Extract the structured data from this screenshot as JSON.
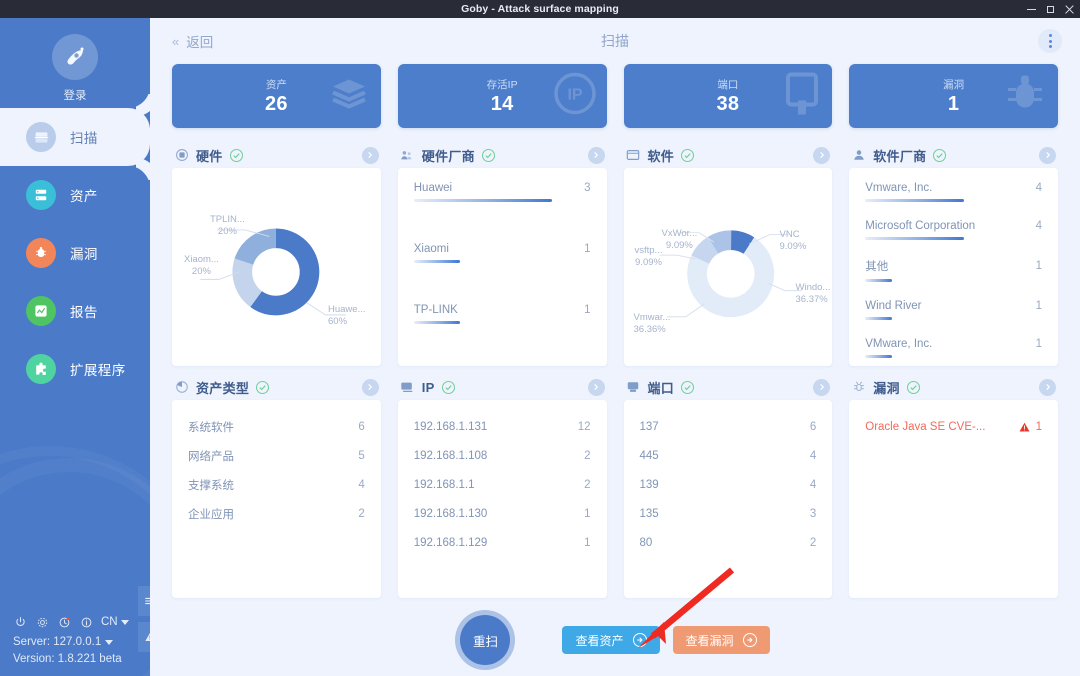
{
  "window": {
    "title": "Goby - Attack surface mapping",
    "minimize": "minimize-icon",
    "maximize": "maximize-icon",
    "close": "close-icon"
  },
  "sidebar": {
    "login_label": "登录",
    "items": [
      {
        "label": "扫描",
        "icon": "scan-icon",
        "color": "#b9cdeb",
        "active": true
      },
      {
        "label": "资产",
        "icon": "assets-icon",
        "color": "#3bbfd8",
        "active": false
      },
      {
        "label": "漏洞",
        "icon": "bug-icon",
        "color": "#f2865a",
        "active": false
      },
      {
        "label": "报告",
        "icon": "report-icon",
        "color": "#4ec463",
        "active": false
      },
      {
        "label": "扩展程序",
        "icon": "puzzle-icon",
        "color": "#4fd3a0",
        "active": false
      }
    ],
    "bottom": {
      "power_icon": "power-icon",
      "settings_icon": "gear-icon",
      "history_icon": "clock-icon",
      "info_icon": "info-icon",
      "language": "CN",
      "server": "Server: 127.0.0.1",
      "version": "Version: 1.8.221 beta",
      "menu_tab_icon": "hamburger-icon",
      "alert_tab_icon": "warning-icon"
    }
  },
  "topbar": {
    "back": "返回",
    "back_chevron": "«",
    "title": "扫描",
    "more_icon": "kebab-menu-icon"
  },
  "stats": [
    {
      "label": "资产",
      "value": "26",
      "bg_icon": "layers-icon"
    },
    {
      "label": "存活IP",
      "value": "14",
      "bg_icon": "ip-icon"
    },
    {
      "label": "端口",
      "value": "38",
      "bg_icon": "port-icon"
    },
    {
      "label": "漏洞",
      "value": "1",
      "bg_icon": "bug-icon"
    }
  ],
  "panels": {
    "hardware": {
      "title": "硬件",
      "icon": "chip-icon",
      "check_icon": "check-circle-icon",
      "arrow_icon": "chevron-right-icon"
    },
    "hardware_vendor": {
      "title": "硬件厂商",
      "icon": "factory-icon",
      "check_icon": "check-circle-icon",
      "arrow_icon": "chevron-right-icon",
      "items": [
        {
          "name": "Huawei",
          "value": "3",
          "pct": 100
        },
        {
          "name": "Xiaomi",
          "value": "1",
          "pct": 33
        },
        {
          "name": "TP-LINK",
          "value": "1",
          "pct": 33
        }
      ]
    },
    "software": {
      "title": "软件",
      "icon": "window-icon",
      "check_icon": "check-circle-icon",
      "arrow_icon": "chevron-right-icon"
    },
    "software_vendor": {
      "title": "软件厂商",
      "icon": "user-icon",
      "check_icon": "check-circle-icon",
      "arrow_icon": "chevron-right-icon",
      "items": [
        {
          "name": "Vmware, Inc.",
          "value": "4",
          "pct": 100
        },
        {
          "name": "Microsoft Corporation",
          "value": "4",
          "pct": 100
        },
        {
          "name": "其他",
          "value": "1",
          "pct": 27
        },
        {
          "name": "Wind River",
          "value": "1",
          "pct": 27
        },
        {
          "name": "VMware, Inc.",
          "value": "1",
          "pct": 27
        }
      ]
    },
    "asset_type": {
      "title": "资产类型",
      "icon": "pie-icon",
      "check_icon": "check-circle-icon",
      "arrow_icon": "chevron-right-icon",
      "items": [
        {
          "name": "系统软件",
          "value": "6"
        },
        {
          "name": "网络产品",
          "value": "5"
        },
        {
          "name": "支撑系统",
          "value": "4"
        },
        {
          "name": "企业应用",
          "value": "2"
        }
      ]
    },
    "ip": {
      "title": "IP",
      "icon": "monitor-icon",
      "check_icon": "check-circle-icon",
      "arrow_icon": "chevron-right-icon",
      "items": [
        {
          "name": "192.168.1.131",
          "value": "12"
        },
        {
          "name": "192.168.1.108",
          "value": "2"
        },
        {
          "name": "192.168.1.1",
          "value": "2"
        },
        {
          "name": "192.168.1.130",
          "value": "1"
        },
        {
          "name": "192.168.1.129",
          "value": "1"
        }
      ]
    },
    "port": {
      "title": "端口",
      "icon": "server-icon",
      "check_icon": "check-circle-icon",
      "arrow_icon": "chevron-right-icon",
      "items": [
        {
          "name": "137",
          "value": "6"
        },
        {
          "name": "445",
          "value": "4"
        },
        {
          "name": "139",
          "value": "4"
        },
        {
          "name": "135",
          "value": "3"
        },
        {
          "name": "80",
          "value": "2"
        }
      ]
    },
    "vuln": {
      "title": "漏洞",
      "icon": "bug-outline-icon",
      "check_icon": "check-circle-icon",
      "arrow_icon": "chevron-right-icon",
      "items": [
        {
          "name": "Oracle Java SE CVE-...",
          "value": "1",
          "severity_icon": "warning-triangle-icon"
        }
      ]
    }
  },
  "footer": {
    "rescan": "重扫",
    "view_assets": "查看资产",
    "view_vulns": "查看漏洞",
    "arrow_icon": "arrow-right-circle-icon"
  },
  "chart_data": [
    {
      "type": "pie",
      "title": "硬件",
      "legend": "labels",
      "categories": [
        "Huawe...",
        "TPLIN...",
        "Xiaom..."
      ],
      "values": [
        60,
        20,
        20
      ],
      "labels": [
        "60%",
        "20%",
        "20%"
      ],
      "colors": [
        "#4a7ac8",
        "#c3d4ec",
        "#8fb0dd"
      ]
    },
    {
      "type": "pie",
      "title": "软件",
      "legend": "labels",
      "categories": [
        "VNC",
        "Windo...",
        "Vmwar...",
        "vsftp...",
        "VxWor..."
      ],
      "values": [
        9.09,
        36.37,
        36.36,
        9.09,
        9.09
      ],
      "labels": [
        "9.09%",
        "36.37%",
        "36.36%",
        "9.09%",
        "9.09%"
      ],
      "colors": [
        "#4a7ac8",
        "#e4ecf8",
        "#e4ecf8",
        "#c3d4ec",
        "#a9c1e4"
      ]
    }
  ]
}
